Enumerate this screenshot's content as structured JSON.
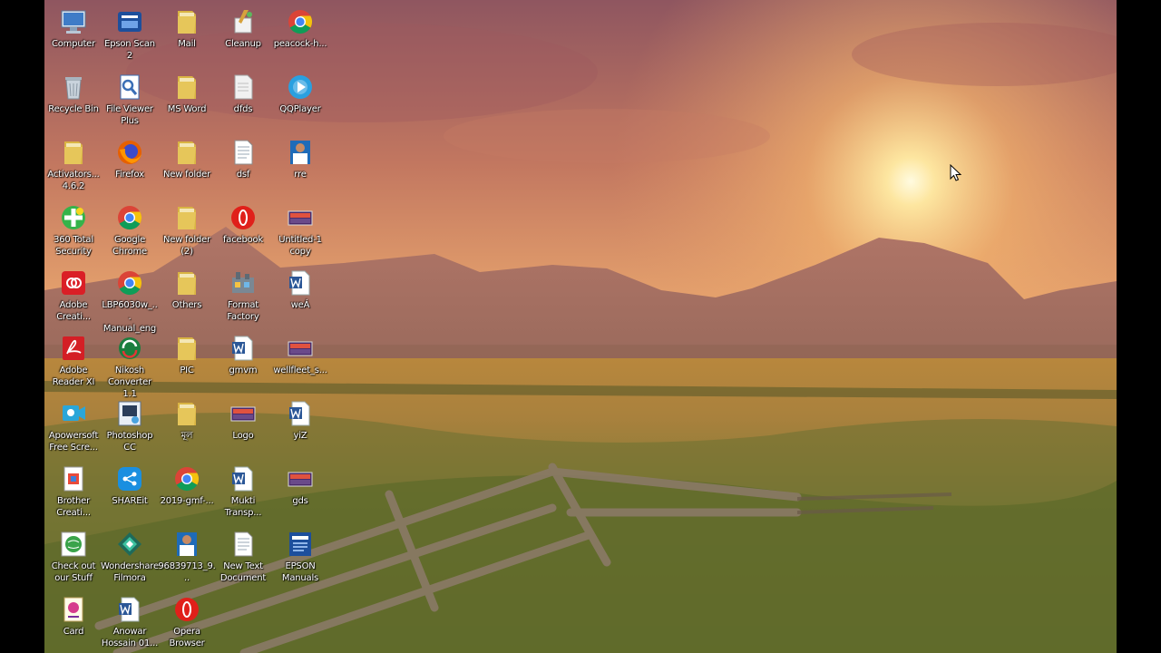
{
  "desktop": {
    "icons": [
      {
        "label": "Computer",
        "icon": "computer-icon"
      },
      {
        "label": "Epson Scan 2",
        "icon": "scanner-icon"
      },
      {
        "label": "Mail",
        "icon": "folder-icon"
      },
      {
        "label": "Cleanup",
        "icon": "cleanup-icon"
      },
      {
        "label": "peacock-h...",
        "icon": "chrome-icon"
      },
      {
        "label": "Recycle Bin",
        "icon": "recycle-bin-icon"
      },
      {
        "label": "File Viewer\nPlus",
        "icon": "file-viewer-icon"
      },
      {
        "label": "MS Word",
        "icon": "folder-icon"
      },
      {
        "label": "dfds",
        "icon": "document-icon"
      },
      {
        "label": "QQPlayer",
        "icon": "qqplayer-icon"
      },
      {
        "label": "Activators...\n4.6.2",
        "icon": "folder-icon"
      },
      {
        "label": "Firefox",
        "icon": "firefox-icon"
      },
      {
        "label": "New folder",
        "icon": "folder-icon"
      },
      {
        "label": "dsf",
        "icon": "text-document-icon"
      },
      {
        "label": "rre",
        "icon": "photo-icon"
      },
      {
        "label": "360 Total\nSecurity",
        "icon": "security-icon"
      },
      {
        "label": "Google\nChrome",
        "icon": "chrome-icon"
      },
      {
        "label": "New folder\n(2)",
        "icon": "folder-icon"
      },
      {
        "label": "facebook",
        "icon": "opera-icon"
      },
      {
        "label": "Untitled-1\ncopy",
        "icon": "image-file-icon"
      },
      {
        "label": "Adobe\nCreati...",
        "icon": "adobe-cc-icon"
      },
      {
        "label": "LBP6030w_...\nManual_eng",
        "icon": "chrome-icon"
      },
      {
        "label": "Others",
        "icon": "folder-icon"
      },
      {
        "label": "Format\nFactory",
        "icon": "format-factory-icon"
      },
      {
        "label": "weÁ",
        "icon": "word-doc-icon"
      },
      {
        "label": "Adobe\nReader XI",
        "icon": "adobe-reader-icon"
      },
      {
        "label": "Nikosh\nConverter 1.1",
        "icon": "converter-icon"
      },
      {
        "label": "PIC",
        "icon": "folder-icon"
      },
      {
        "label": "gmvm",
        "icon": "word-doc-icon"
      },
      {
        "label": "wellfleet_s...",
        "icon": "image-file-icon"
      },
      {
        "label": "Apowersoft\nFree Scre...",
        "icon": "recorder-icon"
      },
      {
        "label": "Photoshop\nCC",
        "icon": "photoshop-icon"
      },
      {
        "label": "মূল",
        "icon": "folder-icon"
      },
      {
        "label": "Logo",
        "icon": "image-file-icon"
      },
      {
        "label": "yiZ",
        "icon": "word-doc-icon"
      },
      {
        "label": "Brother\nCreati...",
        "icon": "brother-icon"
      },
      {
        "label": "SHAREit",
        "icon": "shareit-icon"
      },
      {
        "label": "2019-gmf-...",
        "icon": "chrome-icon"
      },
      {
        "label": "Mukti\nTransp...",
        "icon": "word-doc-icon"
      },
      {
        "label": "gds",
        "icon": "image-file-icon"
      },
      {
        "label": "Check out\nour Stuff",
        "icon": "web-shortcut-icon"
      },
      {
        "label": "Wondershare\nFilmora",
        "icon": "filmora-icon"
      },
      {
        "label": "96839713_9...",
        "icon": "photo-icon"
      },
      {
        "label": "New Text\nDocument",
        "icon": "text-document-icon"
      },
      {
        "label": "EPSON\nManuals",
        "icon": "epson-icon"
      },
      {
        "label": "Card",
        "icon": "card-icon"
      },
      {
        "label": "Anowar\nHossain 01...",
        "icon": "word-doc-icon"
      },
      {
        "label": "Opera\nBrowser",
        "icon": "opera-icon"
      }
    ]
  },
  "colors": {
    "sky_top": "#a9605e",
    "sky_glow": "#f7c27a",
    "mountain": "#a4695e",
    "meadow": "#b48a3c",
    "folder": "#e6c65a",
    "word_blue": "#2b5797",
    "chrome_red": "#db4437",
    "chrome_yellow": "#f4c20d",
    "chrome_green": "#0f9d58"
  },
  "cursor": {
    "icon": "mouse-pointer-icon"
  }
}
